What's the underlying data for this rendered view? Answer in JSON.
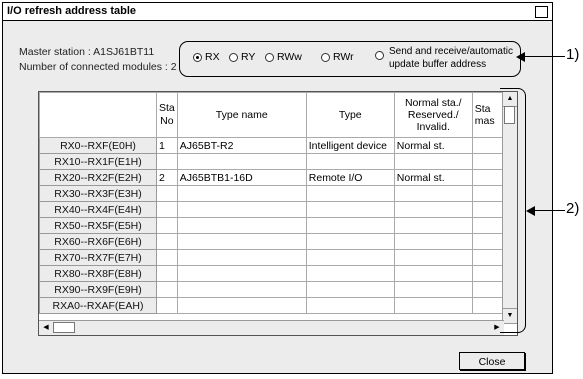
{
  "window": {
    "title": "I/O refresh address table"
  },
  "info": {
    "master_station": "Master station : A1SJ61BT11",
    "connected_modules": "Number of connected modules : 2"
  },
  "radio": {
    "options": [
      "RX",
      "RY",
      "RWw",
      "RWr"
    ],
    "selected": "RX",
    "last_option": "Send and receive/automatic update buffer address"
  },
  "table": {
    "headers": [
      "",
      "Sta No",
      "Type name",
      "Type",
      "Normal sta./ Reserved./ Invalid.",
      "Sta mas"
    ],
    "rows": [
      {
        "addr": "RX0--RXF(E0H)",
        "sta": "1",
        "type_name": "AJ65BT-R2",
        "type": "Intelligent device",
        "normal": "Normal st."
      },
      {
        "addr": "RX10--RX1F(E1H)",
        "sta": "",
        "type_name": "",
        "type": "",
        "normal": ""
      },
      {
        "addr": "RX20--RX2F(E2H)",
        "sta": "2",
        "type_name": "AJ65BTB1-16D",
        "type": "Remote I/O",
        "normal": "Normal st."
      },
      {
        "addr": "RX30--RX3F(E3H)",
        "sta": "",
        "type_name": "",
        "type": "",
        "normal": ""
      },
      {
        "addr": "RX40--RX4F(E4H)",
        "sta": "",
        "type_name": "",
        "type": "",
        "normal": ""
      },
      {
        "addr": "RX50--RX5F(E5H)",
        "sta": "",
        "type_name": "",
        "type": "",
        "normal": ""
      },
      {
        "addr": "RX60--RX6F(E6H)",
        "sta": "",
        "type_name": "",
        "type": "",
        "normal": ""
      },
      {
        "addr": "RX70--RX7F(E7H)",
        "sta": "",
        "type_name": "",
        "type": "",
        "normal": ""
      },
      {
        "addr": "RX80--RX8F(E8H)",
        "sta": "",
        "type_name": "",
        "type": "",
        "normal": ""
      },
      {
        "addr": "RX90--RX9F(E9H)",
        "sta": "",
        "type_name": "",
        "type": "",
        "normal": ""
      },
      {
        "addr": "RXA0--RXAF(EAH)",
        "sta": "",
        "type_name": "",
        "type": "",
        "normal": ""
      }
    ]
  },
  "buttons": {
    "close": "Close"
  },
  "callouts": {
    "one": "1)",
    "two": "2)"
  }
}
